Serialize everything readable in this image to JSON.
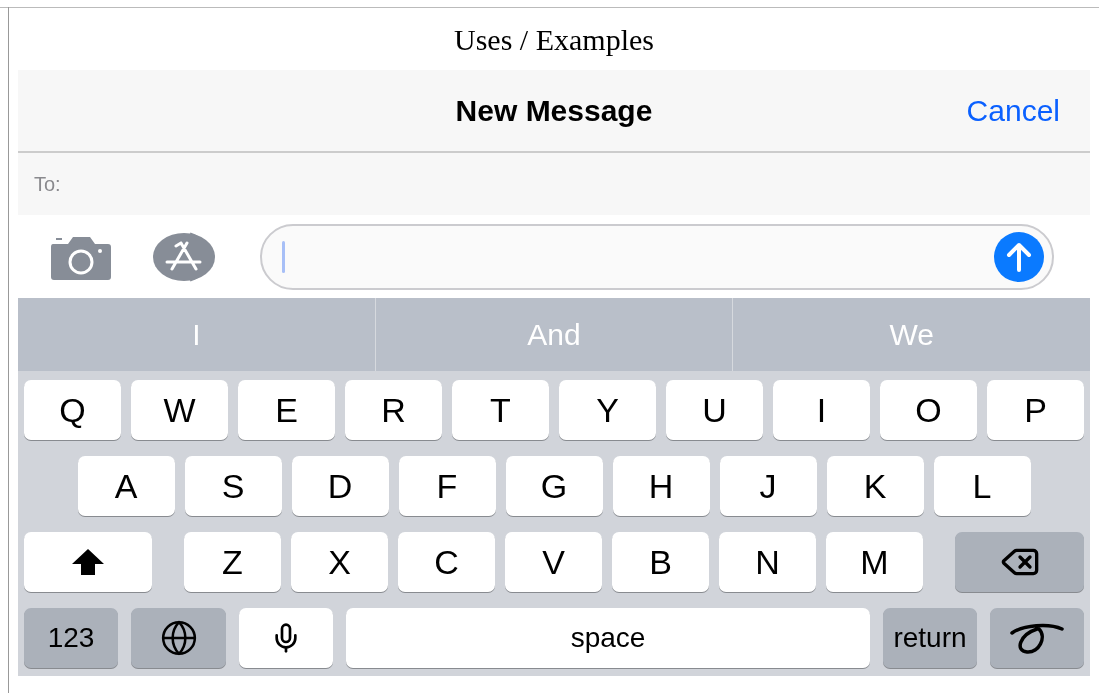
{
  "page_title": "Uses / Examples",
  "nav": {
    "title": "New Message",
    "action": "Cancel"
  },
  "to_field": {
    "label": "To:"
  },
  "suggestions": [
    "I",
    "And",
    "We"
  ],
  "keyboard": {
    "rows": [
      [
        {
          "kind": "letter",
          "label": "Q"
        },
        {
          "kind": "letter",
          "label": "W"
        },
        {
          "kind": "letter",
          "label": "E"
        },
        {
          "kind": "letter",
          "label": "R"
        },
        {
          "kind": "letter",
          "label": "T"
        },
        {
          "kind": "letter",
          "label": "Y"
        },
        {
          "kind": "letter",
          "label": "U"
        },
        {
          "kind": "letter",
          "label": "I"
        },
        {
          "kind": "letter",
          "label": "O"
        },
        {
          "kind": "letter",
          "label": "P"
        }
      ],
      [
        {
          "kind": "letter",
          "label": "A"
        },
        {
          "kind": "letter",
          "label": "S"
        },
        {
          "kind": "letter",
          "label": "D"
        },
        {
          "kind": "letter",
          "label": "F"
        },
        {
          "kind": "letter",
          "label": "G"
        },
        {
          "kind": "letter",
          "label": "H"
        },
        {
          "kind": "letter",
          "label": "J"
        },
        {
          "kind": "letter",
          "label": "K"
        },
        {
          "kind": "letter",
          "label": "L"
        }
      ],
      [
        {
          "kind": "shift"
        },
        {
          "kind": "letter",
          "label": "Z"
        },
        {
          "kind": "letter",
          "label": "X"
        },
        {
          "kind": "letter",
          "label": "C"
        },
        {
          "kind": "letter",
          "label": "V"
        },
        {
          "kind": "letter",
          "label": "B"
        },
        {
          "kind": "letter",
          "label": "N"
        },
        {
          "kind": "letter",
          "label": "M"
        },
        {
          "kind": "delete"
        }
      ],
      [
        {
          "kind": "mode",
          "label": "123"
        },
        {
          "kind": "globe"
        },
        {
          "kind": "mic"
        },
        {
          "kind": "space",
          "label": "space"
        },
        {
          "kind": "return",
          "label": "return"
        },
        {
          "kind": "handwriting"
        }
      ]
    ]
  }
}
